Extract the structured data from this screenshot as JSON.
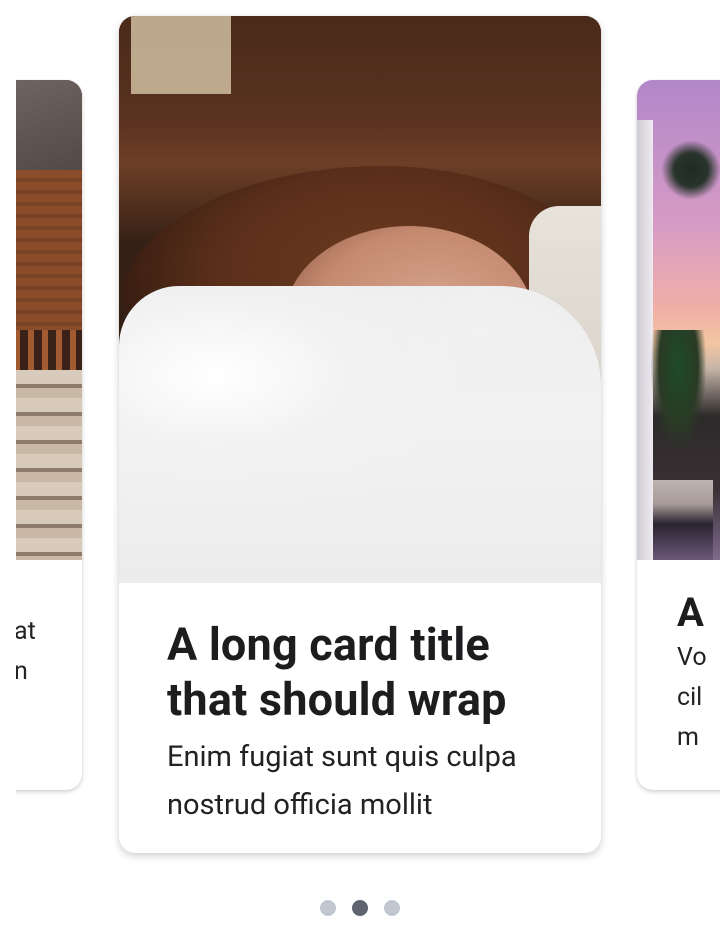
{
  "carousel": {
    "cards": [
      {
        "position": "previous",
        "image_alt": "wooden house with porch",
        "title": "",
        "body": "at\nn"
      },
      {
        "position": "current",
        "image_alt": "woman lying in bed under white blanket",
        "title": "A long card title that should wrap",
        "body": "Enim fugiat sunt quis culpa nostrud officia mollit"
      },
      {
        "position": "next",
        "image_alt": "resort pool with palm trees at sunset",
        "title": "A",
        "body": "Vo\ncil\nm"
      }
    ],
    "pagination": {
      "count": 3,
      "active_index": 1
    }
  },
  "colors": {
    "dot_inactive": "#c2c6d0",
    "dot_active": "#5e6470",
    "title_text": "#1d1d1f"
  }
}
